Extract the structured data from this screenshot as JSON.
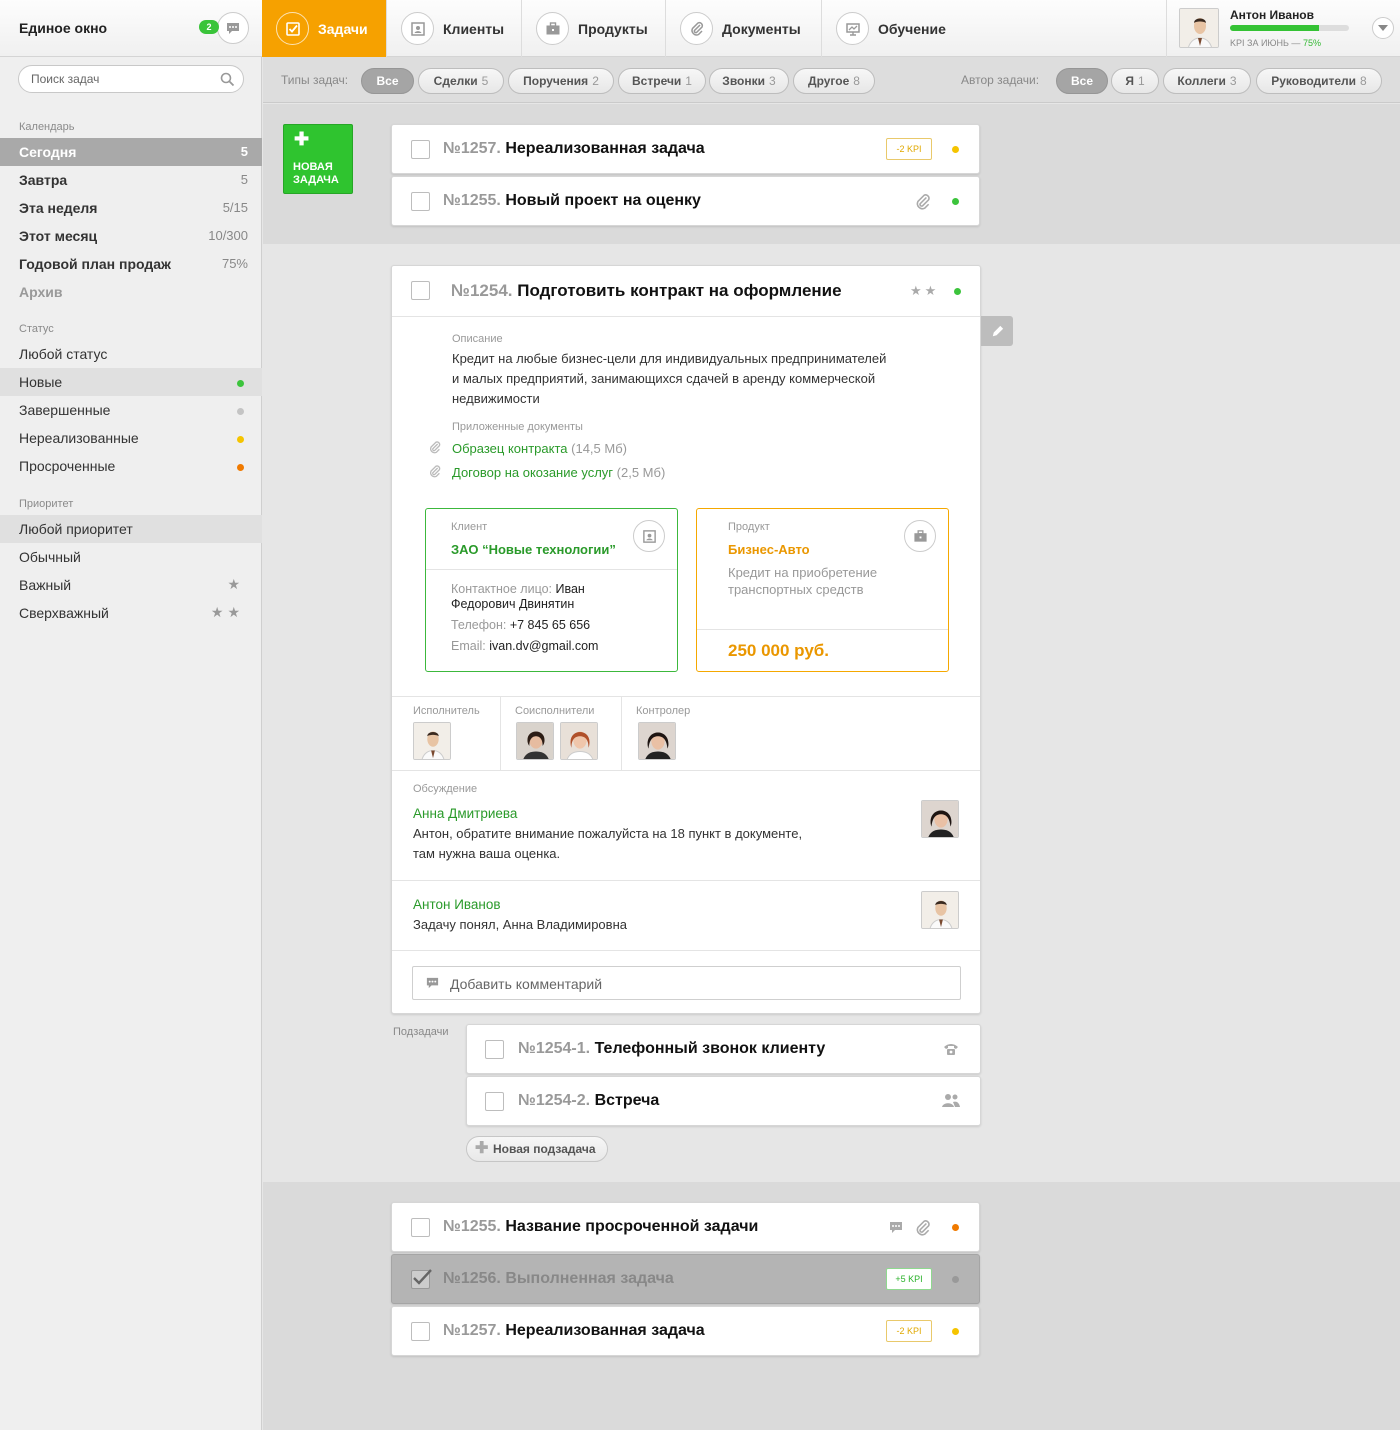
{
  "app": {
    "brand": "Единое окно",
    "messages_count": "2"
  },
  "nav": {
    "tasks": "Задачи",
    "clients": "Клиенты",
    "products": "Продукты",
    "documents": "Документы",
    "training": "Обучение"
  },
  "user": {
    "name": "Антон Иванов",
    "kpi_label": "KPI ЗА ИЮНЬ —",
    "kpi_value": "75%",
    "kpi_fraction": 0.75
  },
  "sidebar": {
    "search_placeholder": "Поиск задач",
    "calendar_head": "Календарь",
    "calendar": [
      {
        "label": "Сегодня",
        "count": "5"
      },
      {
        "label": "Завтра",
        "count": "5"
      },
      {
        "label": "Эта неделя",
        "count": "5/15"
      },
      {
        "label": "Этот месяц",
        "count": "10/300"
      },
      {
        "label": "Годовой план продаж",
        "count": "75%"
      },
      {
        "label": "Архив",
        "count": ""
      }
    ],
    "status_head": "Статус",
    "status": [
      {
        "label": "Любой статус"
      },
      {
        "label": "Новые"
      },
      {
        "label": "Завершенные"
      },
      {
        "label": "Нереализованные"
      },
      {
        "label": "Просроченные"
      }
    ],
    "priority_head": "Приоритет",
    "priority": [
      {
        "label": "Любой приоритет"
      },
      {
        "label": "Обычный"
      },
      {
        "label": "Важный",
        "stars": "★"
      },
      {
        "label": "Сверхважный",
        "stars": "★★"
      }
    ]
  },
  "filters": {
    "types_label": "Типы задач:",
    "types": [
      {
        "label": "Все",
        "n": ""
      },
      {
        "label": "Сделки",
        "n": "5"
      },
      {
        "label": "Поручения",
        "n": "2"
      },
      {
        "label": "Встречи",
        "n": "1"
      },
      {
        "label": "Звонки",
        "n": "3"
      },
      {
        "label": "Другое",
        "n": "8"
      }
    ],
    "author_label": "Автор задачи:",
    "authors": [
      {
        "label": "Все",
        "n": ""
      },
      {
        "label": "Я",
        "n": "1"
      },
      {
        "label": "Коллеги",
        "n": "3"
      },
      {
        "label": "Руководители",
        "n": "8"
      }
    ]
  },
  "new_task": {
    "line1": "НОВАЯ",
    "line2": "ЗАДАЧА"
  },
  "tasks_top": [
    {
      "num": "№1257.",
      "title": "Нереализованная задача",
      "kpi": "-2 KPI"
    },
    {
      "num": "№1255.",
      "title": "Новый проект на оценку"
    }
  ],
  "expanded": {
    "num": "№1254.",
    "title": "Подготовить контракт на оформление",
    "stars": "★★",
    "desc_label": "Описание",
    "desc_line1": "Кредит на любые бизнес-цели для индивидуальных предпринимателей",
    "desc_line2": "и малых предприятий, занимающихся сдачей в аренду коммерческой",
    "desc_line3": "недвижимости",
    "docs_label": "Приложенные документы",
    "docs": [
      {
        "name": "Образец контракта",
        "size": "(14,5 Мб)"
      },
      {
        "name": "Договор на окозание услуг",
        "size": "(2,5 Мб)"
      }
    ],
    "client": {
      "label": "Клиент",
      "name": "ЗАО “Новые технологии”",
      "contact_label": "Контактное лицо:",
      "contact_first": "Иван",
      "contact_rest": "Федорович Двинятин",
      "phone_label": "Телефон:",
      "phone": "+7 845 65 656",
      "email_label": "Email:",
      "email": "ivan.dv@gmail.com"
    },
    "product": {
      "label": "Продукт",
      "name": "Бизнес-Авто",
      "desc1": "Кредит на приобретение",
      "desc2": "транспортных средств",
      "price": "250 000 руб."
    },
    "executor_label": "Исполнитель",
    "coexec_label": "Соисполнители",
    "controller_label": "Контролер",
    "discussion_label": "Обсуждение",
    "comments": [
      {
        "author": "Анна Дмитриева",
        "line1": "Антон, обратите внимание пожалуйста на 18 пункт в документе,",
        "line2": "там нужна ваша оценка."
      },
      {
        "author": "Антон Иванов",
        "line1": "Задачу понял, Анна Владимировна",
        "line2": ""
      }
    ],
    "comment_placeholder": "Добавить комментарий"
  },
  "subtasks_label": "Подзадачи",
  "subtasks": [
    {
      "num": "№1254-1.",
      "title": "Телефонный звонок клиенту"
    },
    {
      "num": "№1254-2.",
      "title": "Встреча"
    }
  ],
  "new_subtask": "Новая подзадача",
  "tasks_bottom": [
    {
      "num": "№1255.",
      "title": "Название просроченной задачи"
    },
    {
      "num": "№1256.",
      "title": "Выполненная задача",
      "kpi": "+5 KPI"
    },
    {
      "num": "№1257.",
      "title": "Нереализованная задача",
      "kpi": "-2 KPI"
    }
  ],
  "colors": {
    "accent": "#f6a100",
    "green": "#2fc42f",
    "yellow": "#f5c400",
    "orange": "#f07a00",
    "gray": "#bbbbbb"
  }
}
